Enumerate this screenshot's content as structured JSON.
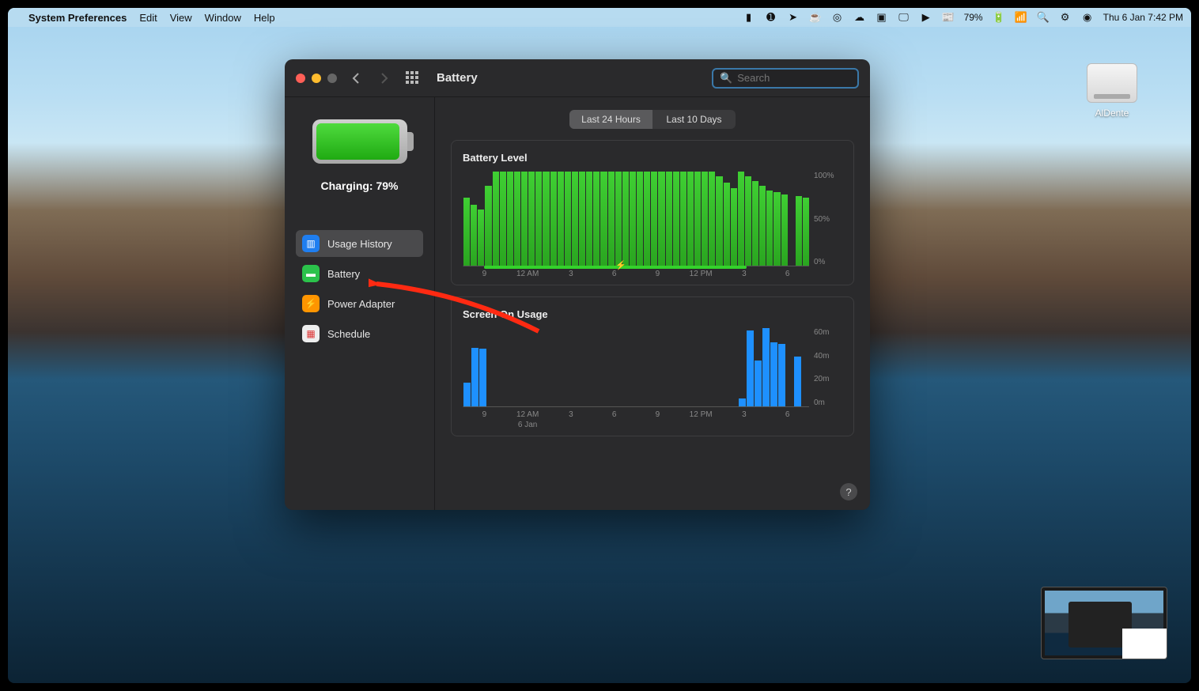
{
  "menubar": {
    "app": "System Preferences",
    "items": [
      "Edit",
      "View",
      "Window",
      "Help"
    ],
    "battery_pct": "79%",
    "datetime": "Thu 6 Jan  7:42 PM"
  },
  "desktop": {
    "disk_label": "AlDente"
  },
  "window": {
    "title": "Battery",
    "search_placeholder": "Search",
    "charging_label": "Charging: 79%",
    "sidebar": [
      {
        "label": "Usage History",
        "icon": "chart-bar-icon",
        "selected": true
      },
      {
        "label": "Battery",
        "icon": "battery-icon",
        "selected": false
      },
      {
        "label": "Power Adapter",
        "icon": "bolt-icon",
        "selected": false
      },
      {
        "label": "Schedule",
        "icon": "calendar-icon",
        "selected": false
      }
    ],
    "segments": {
      "active": "Last 24 Hours",
      "inactive": "Last 10 Days"
    },
    "battery_level_title": "Battery Level",
    "screen_on_title": "Screen On Usage",
    "help_tooltip": "?"
  },
  "chart_data": [
    {
      "type": "bar",
      "title": "Battery Level",
      "ylabel": "",
      "ylim": [
        0,
        100
      ],
      "y_ticks": [
        "100%",
        "50%",
        "0%"
      ],
      "x_ticks": [
        "9",
        "12 AM",
        "3",
        "6",
        "9",
        "12 PM",
        "3",
        "6"
      ],
      "x_sublabel_index": 1,
      "x_sublabel": "",
      "charging_range_pct": [
        6,
        82
      ],
      "values": [
        72,
        65,
        60,
        85,
        100,
        100,
        100,
        100,
        100,
        100,
        100,
        100,
        100,
        100,
        100,
        100,
        100,
        100,
        100,
        100,
        100,
        100,
        100,
        100,
        100,
        100,
        100,
        100,
        100,
        100,
        100,
        100,
        100,
        100,
        100,
        95,
        88,
        82,
        100,
        95,
        90,
        85,
        80,
        78,
        76,
        0,
        74,
        72
      ]
    },
    {
      "type": "bar",
      "title": "Screen On Usage",
      "ylabel": "",
      "ylim": [
        0,
        60
      ],
      "y_ticks": [
        "60m",
        "40m",
        "20m",
        "0m"
      ],
      "x_ticks": [
        "9",
        "12 AM",
        "3",
        "6",
        "9",
        "12 PM",
        "3",
        "6"
      ],
      "x_sublabel_index": 1,
      "x_sublabel": "6 Jan",
      "values": [
        18,
        45,
        44,
        0,
        0,
        0,
        0,
        0,
        0,
        0,
        0,
        0,
        0,
        0,
        0,
        0,
        0,
        0,
        0,
        0,
        0,
        0,
        0,
        0,
        0,
        0,
        0,
        0,
        0,
        0,
        0,
        0,
        0,
        0,
        0,
        6,
        58,
        35,
        60,
        49,
        48,
        0,
        38,
        0
      ]
    }
  ]
}
